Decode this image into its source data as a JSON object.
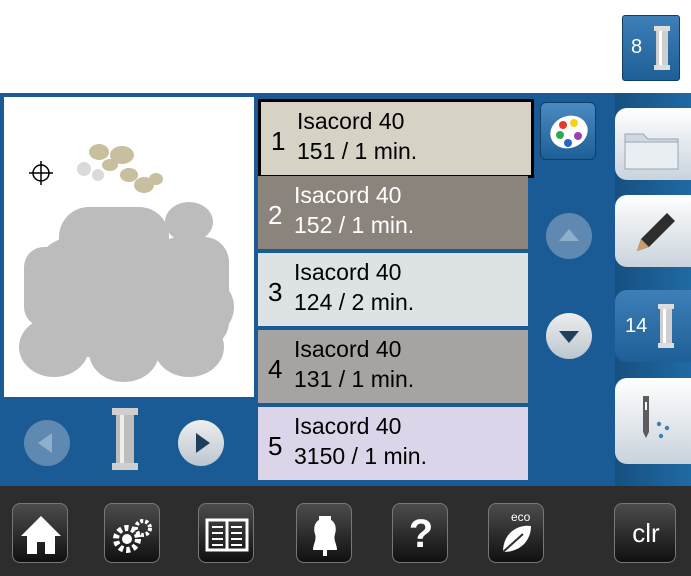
{
  "top_thread": {
    "number": "8"
  },
  "thread_list": [
    {
      "index": "1",
      "brand": "Isacord 40",
      "detail": "151 / 1 min.",
      "bg": "#d6d2c5"
    },
    {
      "index": "2",
      "brand": "Isacord 40",
      "detail": "152 / 1 min.",
      "bg": "#8b847c"
    },
    {
      "index": "3",
      "brand": "Isacord 40",
      "detail": "124 / 2 min.",
      "bg": "#dde2e5"
    },
    {
      "index": "4",
      "brand": "Isacord 40",
      "detail": "131 / 1 min.",
      "bg": "#a5a4a2"
    },
    {
      "index": "5",
      "brand": "Isacord 40",
      "detail": "3150 / 1 min.",
      "bg": "#dcd5ea"
    }
  ],
  "side_tabs": {
    "thread_count": "14"
  },
  "bottom_bar": {
    "clr_label": "clr",
    "eco_label": "eco",
    "help_label": "?"
  },
  "colors": {
    "panel": "#1b5b95",
    "selected_border": "#000000"
  }
}
